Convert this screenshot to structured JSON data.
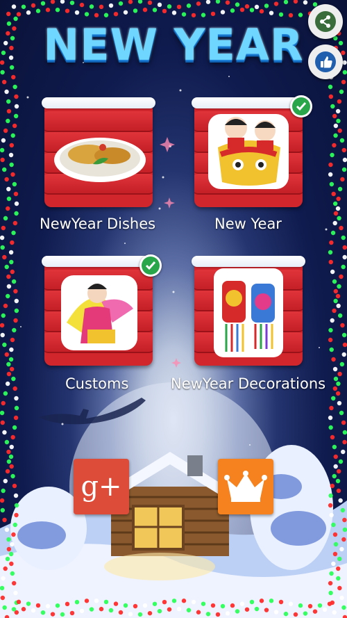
{
  "app": {
    "title": "NEW YEAR"
  },
  "categories": [
    {
      "label": "NewYear Dishes",
      "image": "dish-icon",
      "checked": false
    },
    {
      "label": "New Year",
      "image": "lion-dance-dolls-icon",
      "checked": true
    },
    {
      "label": "Customs",
      "image": "fan-dancer-icon",
      "checked": true
    },
    {
      "label": "NewYear Decorations",
      "image": "chinese-knots-icon",
      "checked": false
    }
  ],
  "side_buttons": {
    "share": "share-icon",
    "like": "thumbs-up-icon"
  },
  "bottom_buttons": {
    "google_plus_label": "g+",
    "premium": "crown-icon"
  },
  "colors": {
    "board_red": "#d2262d",
    "title_blue": "#6fd6ff",
    "check_green": "#2aa64a",
    "google_red": "#dd4b39",
    "crown_orange": "#f5821f"
  }
}
